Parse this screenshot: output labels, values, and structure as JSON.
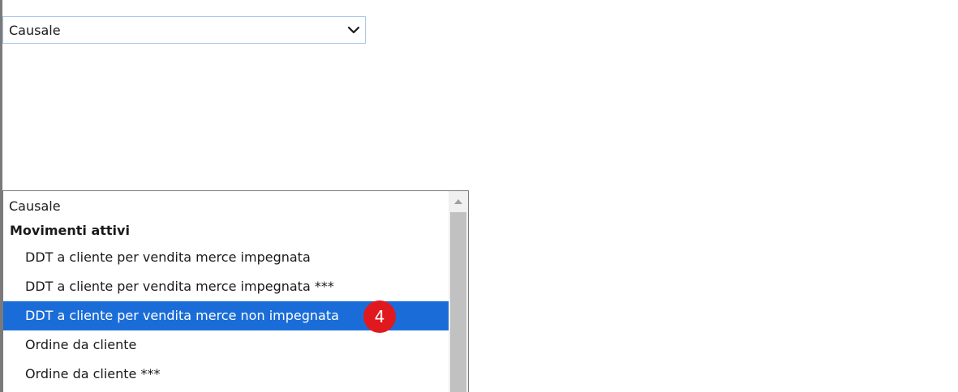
{
  "select": {
    "value": "Causale",
    "icon": "chevron-down-icon"
  },
  "dropdown": {
    "first_option": "Causale",
    "group_label": "Movimenti attivi",
    "options": [
      "DDT a cliente per vendita merce impegnata",
      "DDT a cliente per vendita merce impegnata ***",
      "DDT a cliente per vendita merce non impegnata",
      "Ordine da cliente",
      "Ordine da cliente ***"
    ],
    "selected_index": 2,
    "badge": "4"
  },
  "colors": {
    "selected_bg": "#1a6dd8",
    "badge_bg": "#e0191f",
    "select_border": "#a9c7ec"
  }
}
